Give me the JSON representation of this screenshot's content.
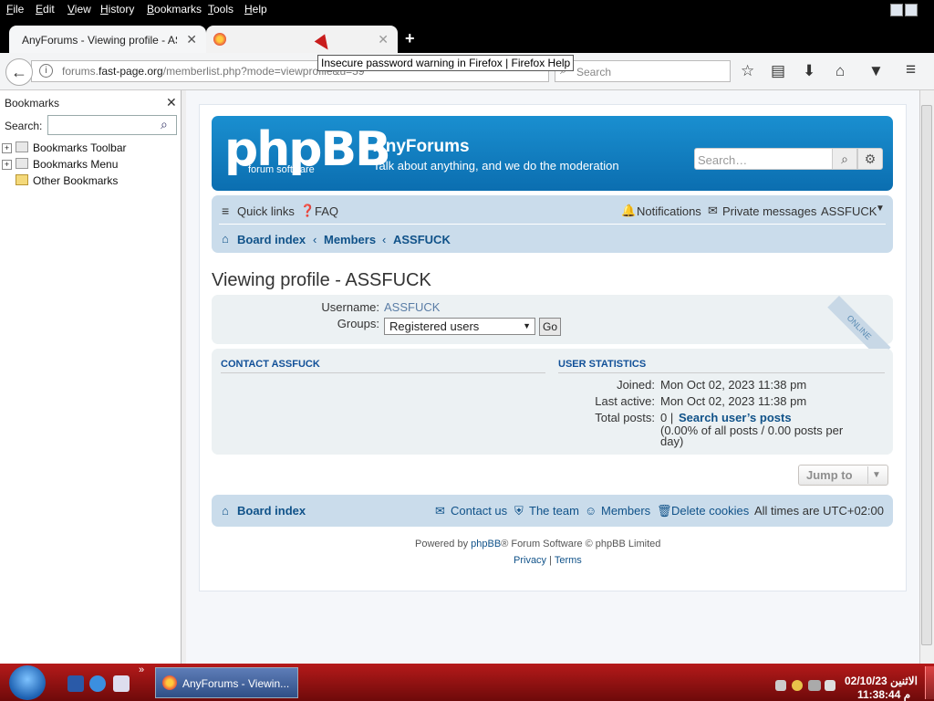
{
  "menubar": {
    "items": [
      "File",
      "Edit",
      "View",
      "History",
      "Bookmarks",
      "Tools",
      "Help"
    ]
  },
  "tabs": [
    {
      "label": "AnyForums - Viewing profile - ASSFUCK",
      "close": "✕"
    },
    {
      "label": "",
      "close": "✕"
    }
  ],
  "tooltip": "Insecure password warning in Firefox | Firefox Help",
  "navbar": {
    "url_domain": "forums.",
    "url_host": "fast-page.org",
    "url_path": "/memberlist.php?mode=viewprofile&u=59",
    "search_placeholder": "Search"
  },
  "sidebar": {
    "title": "Bookmarks",
    "search_label": "Search:",
    "items": [
      "Bookmarks Toolbar",
      "Bookmarks Menu",
      "Other Bookmarks"
    ]
  },
  "forum": {
    "logo": "phpBB",
    "logo_sub": "forum   software",
    "site_name": "AnyForums",
    "site_desc": "Talk about anything, and we do the moderation",
    "search_placeholder": "Search…",
    "quick_links": "Quick links",
    "faq": "FAQ",
    "notifications": "Notifications",
    "private_messages": "Private messages",
    "username": "ASSFUCK",
    "breadcrumbs": [
      "Board index",
      "Members",
      "ASSFUCK"
    ],
    "page_title": "Viewing profile - ASSFUCK",
    "online_badge": "ONLINE",
    "profile": {
      "username_label": "Username:",
      "username_value": "ASSFUCK",
      "groups_label": "Groups:",
      "groups_value": "Registered users",
      "go": "Go"
    },
    "contact_heading": "CONTACT ASSFUCK",
    "stats_heading": "USER STATISTICS",
    "stats": {
      "joined_label": "Joined:",
      "joined_value": "Mon Oct 02, 2023 11:38 pm",
      "last_active_label": "Last active:",
      "last_active_value": "Mon Oct 02, 2023 11:38 pm",
      "total_posts_label": "Total posts:",
      "total_posts_value": "0 |",
      "search_posts": "Search user’s posts",
      "posts_note1": "(0.00% of all posts / 0.00 posts per",
      "posts_note2": "day)"
    },
    "jump_to": "Jump to",
    "footer": {
      "board_index": "Board index",
      "contact": "Contact us",
      "team": "The team",
      "members": "Members",
      "delete_cookies": "Delete cookies",
      "timezone": "All times are UTC+02:00"
    },
    "powered_pre": "Powered by ",
    "powered_link": "phpBB",
    "powered_post": "® Forum Software © phpBB Limited",
    "privacy": "Privacy",
    "sep": "|",
    "terms": "Terms"
  },
  "taskbar": {
    "task_label": "AnyForums - Viewin...",
    "clock_date": "الاثنين 02/10/23",
    "clock_time": "م 11:38:44"
  }
}
